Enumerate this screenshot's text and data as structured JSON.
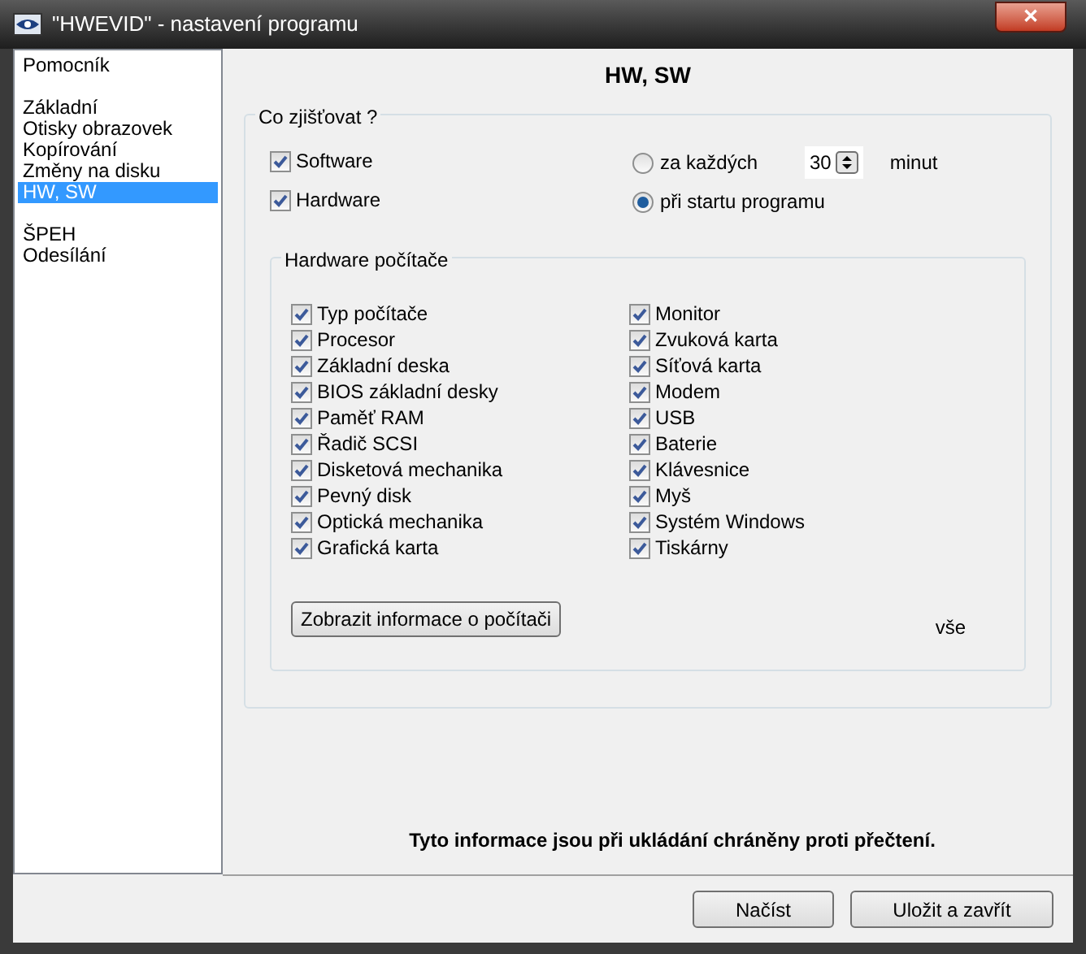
{
  "window": {
    "title": "\"HWEVID\" - nastavení programu",
    "close": "✕"
  },
  "sidebar": {
    "groups": [
      [
        {
          "label": "Pomocník",
          "selected": false
        }
      ],
      [
        {
          "label": "Základní",
          "selected": false
        },
        {
          "label": "Otisky obrazovek",
          "selected": false
        },
        {
          "label": "Kopírování",
          "selected": false
        },
        {
          "label": "Změny na disku",
          "selected": false
        },
        {
          "label": "HW, SW",
          "selected": true
        }
      ],
      [
        {
          "label": "ŠPEH",
          "selected": false
        },
        {
          "label": "Odesílání",
          "selected": false
        }
      ]
    ]
  },
  "page_title": "HW, SW",
  "what_group": {
    "legend": "Co zjišťovat ?",
    "checks": [
      {
        "label": "Software",
        "checked": true
      },
      {
        "label": "Hardware",
        "checked": true
      }
    ],
    "radios": [
      {
        "label": "za každých",
        "selected": false,
        "spin": {
          "value": "30",
          "unit": "minut"
        }
      },
      {
        "label": "při startu programu",
        "selected": true
      }
    ]
  },
  "hardware_group": {
    "legend": "Hardware počítače",
    "columns": [
      [
        {
          "label": "Typ počítače",
          "checked": true
        },
        {
          "label": "Procesor",
          "checked": true
        },
        {
          "label": "Základní deska",
          "checked": true
        },
        {
          "label": "BIOS základní desky",
          "checked": true
        },
        {
          "label": "Paměť RAM",
          "checked": true
        },
        {
          "label": "Řadič SCSI",
          "checked": true
        },
        {
          "label": "Disketová mechanika",
          "checked": true
        },
        {
          "label": "Pevný disk",
          "checked": true
        },
        {
          "label": "Optická mechanika",
          "checked": true
        },
        {
          "label": "Grafická karta",
          "checked": true
        }
      ],
      [
        {
          "label": "Monitor",
          "checked": true
        },
        {
          "label": "Zvuková karta",
          "checked": true
        },
        {
          "label": "Síťová karta",
          "checked": true
        },
        {
          "label": "Modem",
          "checked": true
        },
        {
          "label": "USB",
          "checked": true
        },
        {
          "label": "Baterie",
          "checked": true
        },
        {
          "label": "Klávesnice",
          "checked": true
        },
        {
          "label": "Myš",
          "checked": true
        },
        {
          "label": "Systém Windows",
          "checked": true
        },
        {
          "label": "Tiskárny",
          "checked": true
        }
      ]
    ],
    "show_button": "Zobrazit informace o počítači",
    "all_label": "vše"
  },
  "notice": "Tyto informace jsou při ukládání chráněny proti přečtení.",
  "buttons": [
    "Načíst",
    "Uložit a zavřít"
  ]
}
